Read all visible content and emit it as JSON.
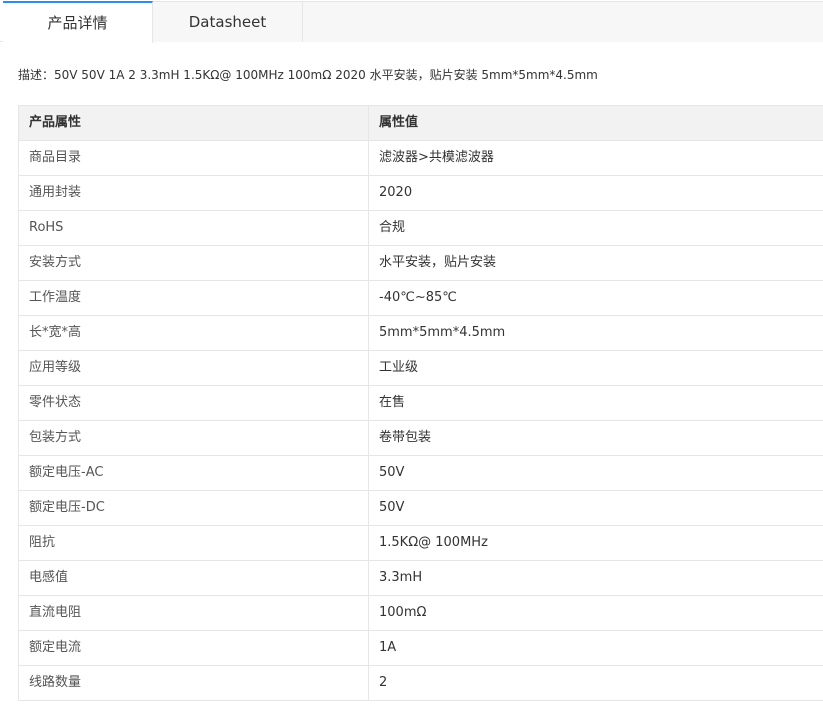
{
  "tabs": {
    "detail_label": "产品详情",
    "datasheet_label": "Datasheet"
  },
  "description": "描述：50V 50V 1A 2 3.3mH 1.5KΩ@ 100MHz 100mΩ 2020 水平安装，贴片安装 5mm*5mm*4.5mm",
  "table": {
    "headers": {
      "attr": "产品属性",
      "value": "属性值"
    },
    "rows": [
      {
        "attr": "商品目录",
        "value": "滤波器>共模滤波器"
      },
      {
        "attr": "通用封装",
        "value": "2020"
      },
      {
        "attr": "RoHS",
        "value": "合规"
      },
      {
        "attr": "安装方式",
        "value": "水平安装，贴片安装"
      },
      {
        "attr": "工作温度",
        "value": "-40℃~85℃"
      },
      {
        "attr": "长*宽*高",
        "value": "5mm*5mm*4.5mm"
      },
      {
        "attr": "应用等级",
        "value": "工业级"
      },
      {
        "attr": "零件状态",
        "value": "在售"
      },
      {
        "attr": "包装方式",
        "value": "卷带包装"
      },
      {
        "attr": "额定电压-AC",
        "value": "50V"
      },
      {
        "attr": "额定电压-DC",
        "value": "50V"
      },
      {
        "attr": "阻抗",
        "value": "1.5KΩ@ 100MHz"
      },
      {
        "attr": "电感值",
        "value": "3.3mH"
      },
      {
        "attr": "直流电阻",
        "value": "100mΩ"
      },
      {
        "attr": "额定电流",
        "value": "1A"
      },
      {
        "attr": "线路数量",
        "value": "2"
      }
    ]
  },
  "colors": {
    "active_tab_accent": "#2d8cf0",
    "header_bg": "#f2f2f2",
    "border": "#e6e6e6"
  }
}
